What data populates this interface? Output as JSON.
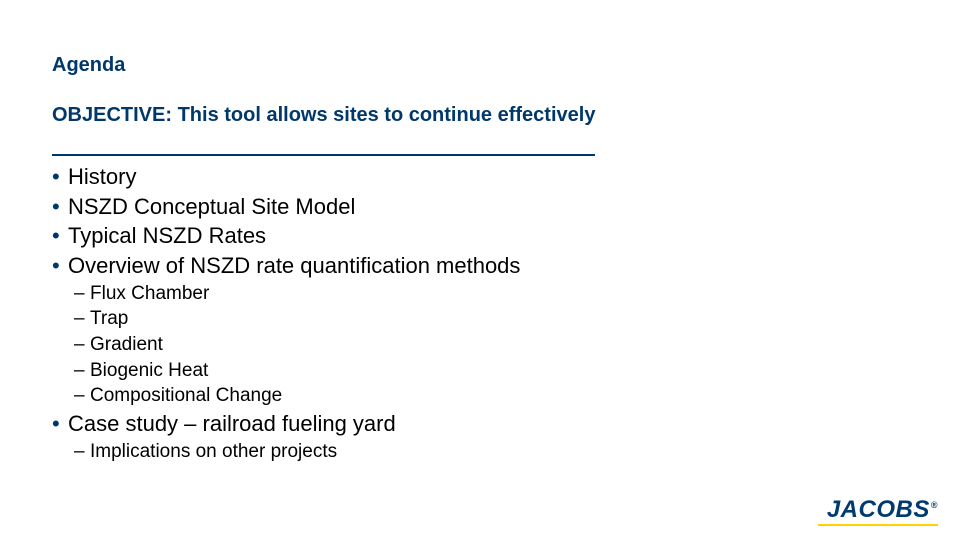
{
  "title": {
    "line1": "Agenda",
    "line2": "OBJECTIVE: This tool allows sites to continue effectively"
  },
  "bullets": {
    "b1": "History",
    "b2": "NSZD Conceptual Site Model",
    "b3": "Typical NSZD Rates",
    "b4": "Overview of NSZD rate quantification methods",
    "b4_sub": {
      "s1": "Flux Chamber",
      "s2": "Trap",
      "s3": "Gradient",
      "s4": "Biogenic Heat",
      "s5": "Compositional Change"
    },
    "b5": "Case study – railroad fueling yard",
    "b5_sub": {
      "s1": "Implications on other projects"
    }
  },
  "logo": {
    "text": "JACOBS",
    "reg": "®"
  }
}
